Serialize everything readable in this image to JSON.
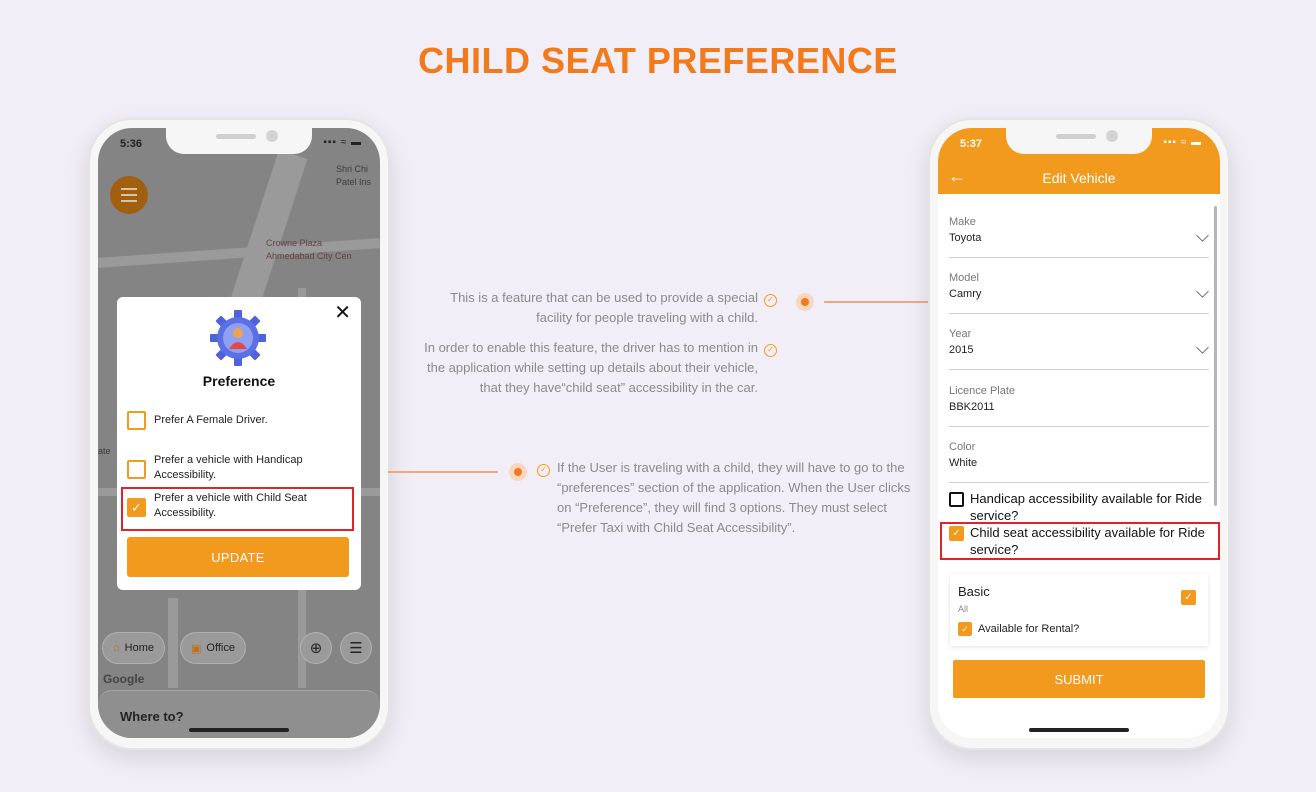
{
  "title": "CHILD SEAT PREFERENCE",
  "left_phone": {
    "status_time": "5:36",
    "status_icons": "▪▪▪ ≈ ▬",
    "map_labels": [
      "Shri Chi",
      "Patel Ins",
      "Crowne Plaza",
      "Ahmedabad City Cen",
      "ate"
    ],
    "dialog": {
      "title": "Preference",
      "close_icon": "✕",
      "options": [
        {
          "label": "Prefer A Female Driver.",
          "checked": false
        },
        {
          "label": "Prefer a vehicle with Handicap Accessibility.",
          "checked": false
        },
        {
          "label": "Prefer a vehicle with Child Seat Accessibility.",
          "checked": true
        }
      ],
      "update_label": "UPDATE"
    },
    "chips": {
      "home": "Home",
      "office": "Office"
    },
    "google_label": "Google",
    "where_to": "Where to?"
  },
  "annotations": {
    "top": "This is a feature that can be used to provide a special facility for people traveling with a child.",
    "middle": "In order to enable this feature, the driver has to mention in the application while setting up details about their vehicle, that they have“child seat” accessibility in the car.",
    "bottom": "If the User is traveling with a child, they will have to go to the “preferences” section of the application. When the User clicks on “Preference”, they will find 3 options. They must select “Prefer Taxi with Child Seat Accessibility”."
  },
  "right_phone": {
    "status_time": "5:37",
    "status_icons": "▪▪▪ ≈ ▬",
    "header_title": "Edit Vehicle",
    "fields": [
      {
        "label": "Make",
        "value": "Toyota",
        "dropdown": true
      },
      {
        "label": "Model",
        "value": "Camry",
        "dropdown": true
      },
      {
        "label": "Year",
        "value": "2015",
        "dropdown": true
      },
      {
        "label": "Licence Plate",
        "value": "BBK2011",
        "dropdown": false
      },
      {
        "label": "Color",
        "value": "White",
        "dropdown": false
      }
    ],
    "handicap_label": "Handicap accessibility available for Ride service?",
    "child_seat_label": "Child seat accessibility available for Ride service?",
    "card": {
      "title": "Basic",
      "subtitle": "All",
      "rental_label": "Available for Rental?"
    },
    "submit_label": "SUBMIT"
  },
  "colors": {
    "accent": "#f29a1d",
    "title": "#f27a1a",
    "highlight": "#e0232a",
    "background": "#f2eef7"
  }
}
